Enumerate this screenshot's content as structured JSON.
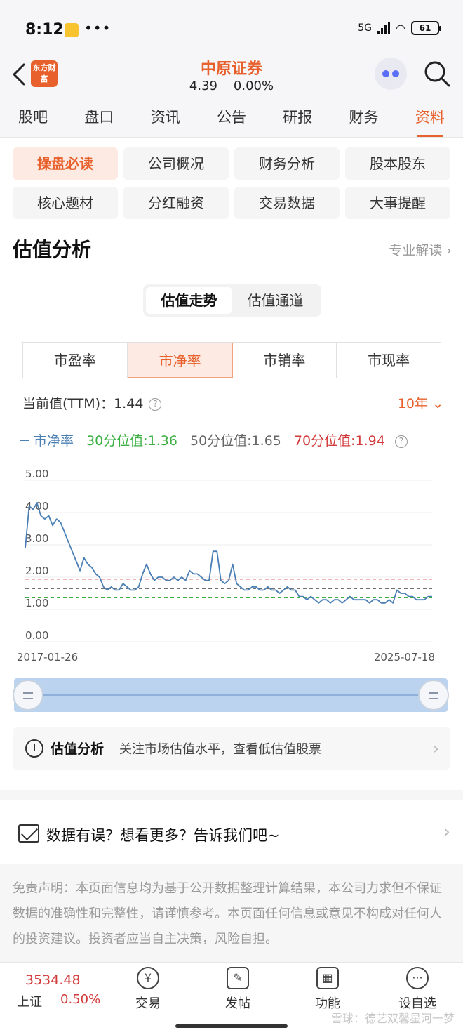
{
  "status": {
    "time": "8:12",
    "network": "5G",
    "battery": "61"
  },
  "header": {
    "logo_text": "东方财富",
    "stock_name": "中原证券",
    "price": "4.39",
    "change": "0.00%"
  },
  "tabs": [
    "股吧",
    "盘口",
    "资讯",
    "公告",
    "研报",
    "财务",
    "资料"
  ],
  "active_tab": 6,
  "subnav": [
    "操盘必读",
    "公司概况",
    "财务分析",
    "股本股东",
    "核心题材",
    "分红融资",
    "交易数据",
    "大事提醒"
  ],
  "section": {
    "title": "估值分析",
    "link": "专业解读 ›"
  },
  "segmented": [
    "估值走势",
    "估值通道"
  ],
  "ratio_tabs": [
    "市盈率",
    "市净率",
    "市销率",
    "市现率"
  ],
  "current_value": "当前值(TTM)：1.44",
  "period": "10年",
  "legend": {
    "series": "市净率",
    "p30": "30分位值:1.36",
    "p50": "50分位值:1.65",
    "p70": "70分位值:1.94"
  },
  "chart_data": {
    "type": "line",
    "title": "",
    "xlabel": "",
    "ylabel": "",
    "ylim": [
      0,
      5
    ],
    "y_ticks": [
      "5.00",
      "4.00",
      "3.00",
      "2.00",
      "1.00",
      "0.00"
    ],
    "x_labels": [
      "2017-01-26",
      "2025-07-18"
    ],
    "series": [
      {
        "name": "市净率",
        "color": "#4a7fb5",
        "values": [
          2.9,
          4.2,
          4.1,
          4.3,
          3.9,
          3.8,
          3.9,
          3.6,
          3.8,
          3.7,
          3.4,
          3.1,
          2.8,
          2.5,
          2.2,
          2.6,
          2.4,
          2.3,
          2.1,
          2.0,
          1.7,
          1.6,
          1.7,
          1.6,
          1.6,
          1.8,
          1.7,
          1.6,
          1.6,
          1.7,
          2.1,
          2.4,
          2.1,
          1.9,
          2.0,
          2.0,
          1.9,
          1.9,
          2.0,
          1.9,
          2.0,
          1.9,
          2.2,
          2.1,
          2.1,
          2.0,
          1.9,
          1.9,
          2.8,
          2.8,
          1.9,
          1.8,
          1.9,
          2.4,
          1.8,
          1.7,
          1.6,
          1.6,
          1.7,
          1.7,
          1.6,
          1.6,
          1.7,
          1.6,
          1.6,
          1.5,
          1.6,
          1.7,
          1.6,
          1.6,
          1.4,
          1.4,
          1.3,
          1.4,
          1.3,
          1.2,
          1.3,
          1.3,
          1.2,
          1.3,
          1.3,
          1.2,
          1.3,
          1.4,
          1.3,
          1.3,
          1.3,
          1.3,
          1.2,
          1.3,
          1.3,
          1.2,
          1.2,
          1.3,
          1.2,
          1.6,
          1.5,
          1.5,
          1.4,
          1.4,
          1.3,
          1.3,
          1.3,
          1.4,
          1.4
        ]
      }
    ],
    "reference_lines": [
      {
        "name": "30分位值",
        "value": 1.36,
        "color": "#3cb043"
      },
      {
        "name": "50分位值",
        "value": 1.65,
        "color": "#444444"
      },
      {
        "name": "70分位值",
        "value": 1.94,
        "color": "#d23b3b"
      }
    ],
    "grid": true
  },
  "banner": {
    "title": "估值分析",
    "text": "关注市场估值水平，查看低估值股票"
  },
  "feedback": {
    "text": "数据有误？想看更多？告诉我们吧~"
  },
  "disclaimer": "免责声明：本页面信息均为基于公开数据整理计算结果，本公司力求但不保证数据的准确性和完整性，请谨慎参考。本页面任何信息或意见不构成对任何人的投资建议。投资者应当自主决策，风险自担。",
  "bottom": {
    "index_value": "3534.48",
    "index_name": "上证",
    "index_change": "0.50%",
    "nav": [
      "交易",
      "发帖",
      "功能",
      "设自选"
    ],
    "watermark": "雪球：德艺双馨星河一梦"
  }
}
